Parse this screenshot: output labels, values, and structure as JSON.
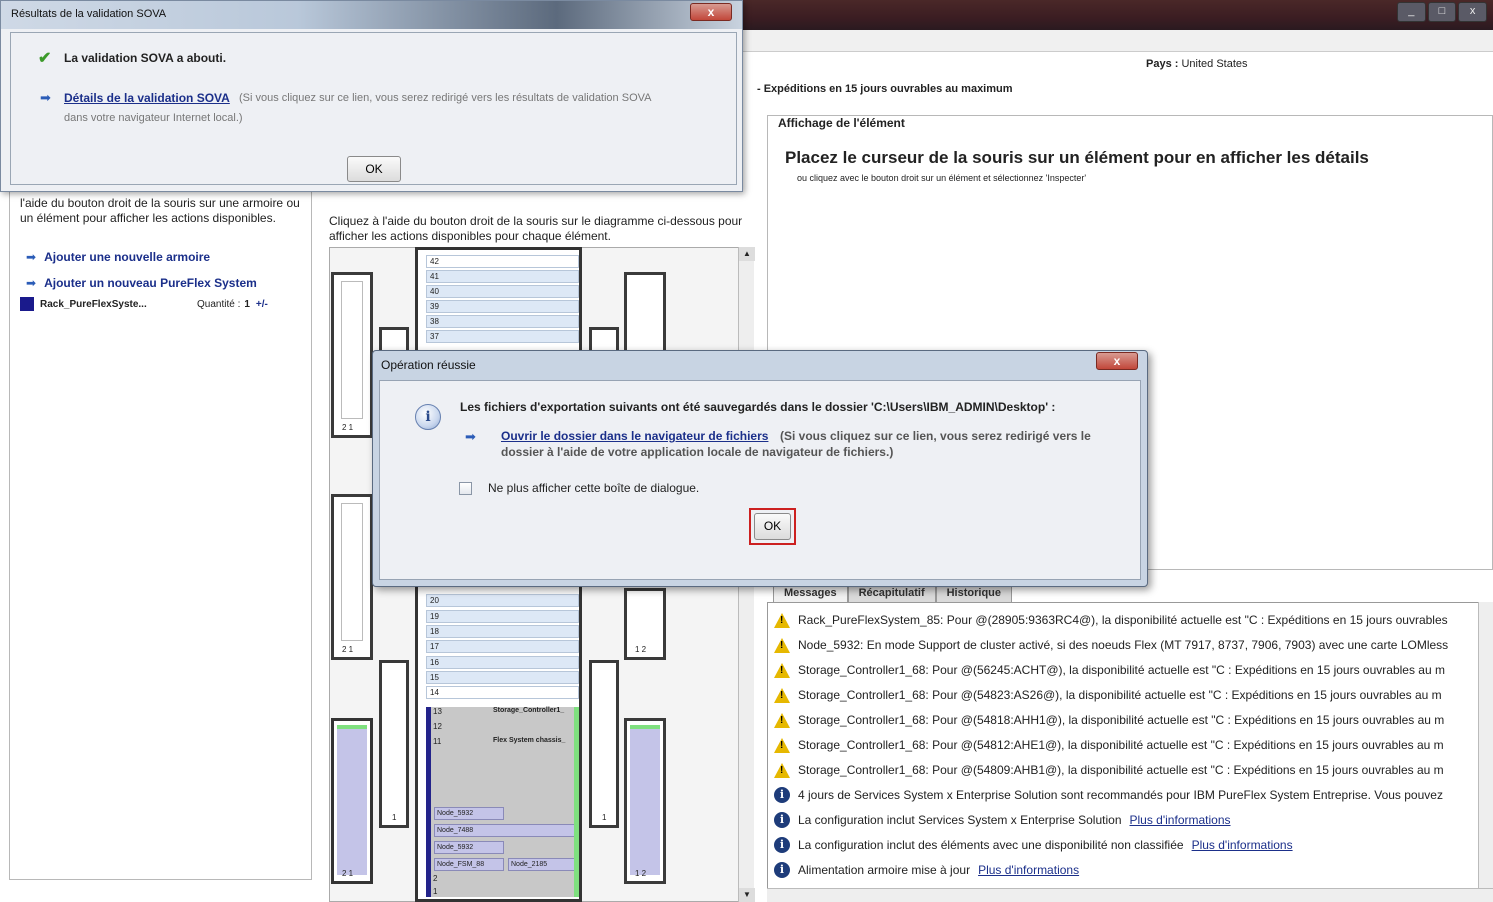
{
  "app": {
    "country_label": "Pays :",
    "country_value": "United States",
    "availability": "- Expéditions en 15 jours ouvrables au maximum",
    "window_min": "_",
    "window_max": "□",
    "window_close": "x"
  },
  "left_panel": {
    "hint": "l'aide du bouton droit de la souris sur une armoire ou un élément pour afficher les actions disponibles.",
    "actions": [
      "Ajouter une nouvelle armoire",
      "Ajouter un nouveau PureFlex System"
    ],
    "rack_name": "Rack_PureFlexSyste...",
    "quantity_label": "Quantité :",
    "quantity_value": "1",
    "quantity_adjust": "+/-"
  },
  "center": {
    "hint": "Cliquez à l'aide du bouton droit de la souris sur le diagramme ci-dessous pour afficher les actions disponibles pour chaque élément.",
    "top_units": [
      "42",
      "41",
      "40",
      "39",
      "38",
      "37"
    ],
    "bottom_units": [
      "20",
      "19",
      "18",
      "17",
      "16",
      "15",
      "14",
      "13",
      "12",
      "11"
    ],
    "labels": {
      "storage": "Storage_Controller1_",
      "chassis": "Flex System chassis_",
      "node_1": "Node_5932",
      "node_2": "Node_7488",
      "node_3": "Node_5932",
      "node_fsm": "Node_FSM_88",
      "node_4": "Node_2185",
      "u2": "2",
      "u1": "1"
    },
    "side_numbers": {
      "upper_left": "2 1",
      "lower_left": "2 1",
      "lower_right": "1 2",
      "bottom_left": "2 1",
      "bottom_right": "1 2",
      "small_left": "1",
      "small_right": "1"
    }
  },
  "element_panel": {
    "title": "Affichage de l'élément",
    "heading": "Placez le curseur de la souris sur un élément pour en afficher les détails",
    "sub": "ou cliquez avec le bouton droit sur un élément et sélectionnez 'Inspecter'"
  },
  "tabs": [
    "Messages",
    "Récapitulatif",
    "Historique"
  ],
  "messages": [
    {
      "type": "warning",
      "text": "Rack_PureFlexSystem_85: Pour @(28905:9363RC4@), la  disponibilité actuelle est \"C : Expéditions en 15 jours ouvrables"
    },
    {
      "type": "warning",
      "text": "Node_5932: En mode Support de cluster activé, si des noeuds Flex (MT 7917, 8737, 7906, 7903) avec une carte LOMless"
    },
    {
      "type": "warning",
      "text": "Storage_Controller1_68: Pour @(56245:ACHT@), la  disponibilité actuelle est \"C : Expéditions en 15 jours ouvrables au m"
    },
    {
      "type": "warning",
      "text": "Storage_Controller1_68: Pour @(54823:AS26@), la  disponibilité actuelle est \"C : Expéditions en 15 jours ouvrables au m"
    },
    {
      "type": "warning",
      "text": "Storage_Controller1_68: Pour @(54818:AHH1@), la  disponibilité actuelle est \"C : Expéditions en 15 jours ouvrables au m"
    },
    {
      "type": "warning",
      "text": "Storage_Controller1_68: Pour @(54812:AHE1@), la  disponibilité actuelle est \"C : Expéditions en 15 jours ouvrables au m"
    },
    {
      "type": "warning",
      "text": "Storage_Controller1_68: Pour @(54809:AHB1@), la  disponibilité actuelle est \"C : Expéditions en 15 jours ouvrables au m"
    },
    {
      "type": "info",
      "text": "4 jours de Services System x Enterprise Solution sont recommandés pour IBM PureFlex System Entreprise. Vous pouvez"
    },
    {
      "type": "info",
      "text": "La configuration inclut Services System x Enterprise Solution",
      "link": "Plus d'informations"
    },
    {
      "type": "info",
      "text": "La configuration inclut des éléments avec une disponibilité non classifiée",
      "link": "Plus d'informations"
    },
    {
      "type": "info",
      "text": "Alimentation armoire mise à jour",
      "link": "Plus d'informations"
    }
  ],
  "sova_dialog": {
    "title": "Résultats de la validation SOVA",
    "close": "x",
    "status": "La validation SOVA a abouti.",
    "link": "Détails de la validation SOVA",
    "link_note": "(Si vous cliquez sur ce lien, vous serez redirigé vers les résultats de validation SOVA",
    "link_note2": "dans votre navigateur Internet local.)",
    "ok": "OK"
  },
  "success_dialog": {
    "title": "Opération réussie",
    "close": "x",
    "message": "Les fichiers d'exportation suivants ont été sauvegardés dans le dossier 'C:\\Users\\IBM_ADMIN\\Desktop' :",
    "link": "Ouvrir le dossier dans le navigateur de fichiers",
    "link_note": "(Si vous cliquez sur ce lien, vous serez redirigé vers le",
    "link_note2": "dossier à l'aide de votre application locale de navigateur de fichiers.)",
    "checkbox_label": "Ne plus afficher cette boîte de dialogue.",
    "checkbox_checked": false,
    "ok": "OK"
  }
}
